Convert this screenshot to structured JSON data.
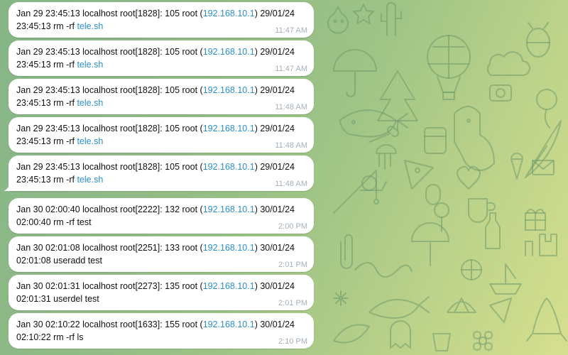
{
  "messages": [
    {
      "t1": "Jan 29 23:45:13 localhost root[1828]:  105  root (",
      "ip": "192.168.10.1",
      "t2": ") 29/01/24",
      "t3": "23:45:13 rm -rf ",
      "cmd": "",
      "file": "tele.sh",
      "time": "11:47 AM"
    },
    {
      "t1": "Jan 29 23:45:13 localhost root[1828]:  105  root (",
      "ip": "192.168.10.1",
      "t2": ") 29/01/24",
      "t3": "23:45:13 rm -rf ",
      "cmd": "",
      "file": "tele.sh",
      "time": "11:47 AM"
    },
    {
      "t1": "Jan 29 23:45:13 localhost root[1828]:  105  root (",
      "ip": "192.168.10.1",
      "t2": ") 29/01/24",
      "t3": "23:45:13 rm -rf ",
      "cmd": "",
      "file": "tele.sh",
      "time": "11:48 AM"
    },
    {
      "t1": "Jan 29 23:45:13 localhost root[1828]:  105  root (",
      "ip": "192.168.10.1",
      "t2": ") 29/01/24",
      "t3": "23:45:13 rm -rf ",
      "cmd": "",
      "file": "tele.sh",
      "time": "11:48 AM"
    },
    {
      "t1": "Jan 29 23:45:13 localhost root[1828]:  105  root (",
      "ip": "192.168.10.1",
      "t2": ") 29/01/24",
      "t3": "23:45:13 rm -rf ",
      "cmd": "",
      "file": "tele.sh",
      "time": "11:48 AM"
    },
    {
      "t1": "Jan 30 02:00:40 localhost root[2222]:  132  root (",
      "ip": "192.168.10.1",
      "t2": ") 30/01/24",
      "t3": "02:00:40 rm -rf test",
      "cmd": "",
      "file": "",
      "time": "2:00 PM"
    },
    {
      "t1": "Jan 30 02:01:08 localhost root[2251]:  133  root (",
      "ip": "192.168.10.1",
      "t2": ") 30/01/24",
      "t3": "02:01:08 useradd test",
      "cmd": "",
      "file": "",
      "time": "2:01 PM"
    },
    {
      "t1": "Jan 30 02:01:31 localhost root[2273]:  135  root (",
      "ip": "192.168.10.1",
      "t2": ") 30/01/24",
      "t3": "02:01:31 userdel test",
      "cmd": "",
      "file": "",
      "time": "2:01 PM"
    },
    {
      "t1": "Jan 30 02:10:22 localhost root[1633]:  155  root (",
      "ip": "192.168.10.1",
      "t2": ") 30/01/24",
      "t3": "02:10:22 rm -rf ls",
      "cmd": "",
      "file": "",
      "time": "2:10 PM"
    }
  ],
  "colors": {
    "link": "#2a8fd0",
    "time": "#a6b0ba",
    "bubble": "#ffffff"
  }
}
